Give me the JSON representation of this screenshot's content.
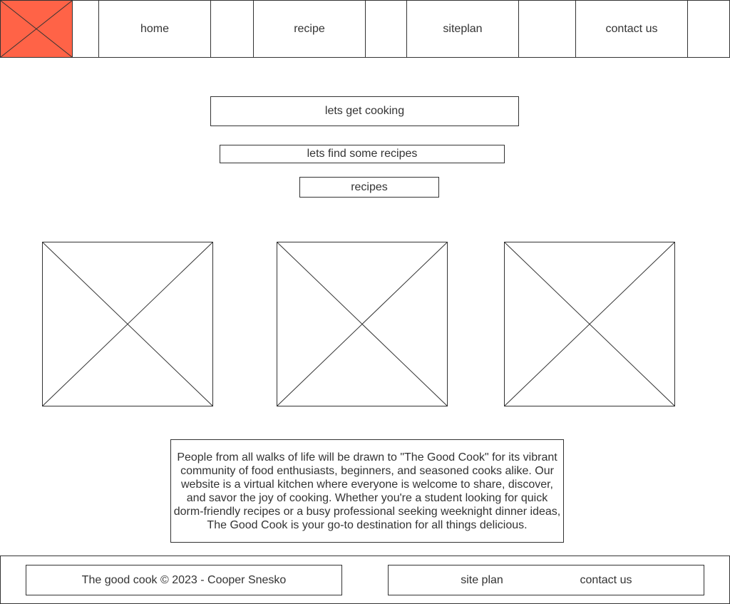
{
  "colors": {
    "logo_fill": "#ff6347",
    "line": "#333333",
    "text": "#333333"
  },
  "header": {
    "logo_icon": "image-placeholder-icon",
    "nav": {
      "home": "home",
      "recipe": "recipe",
      "siteplan": "siteplan",
      "contact": "contact us"
    }
  },
  "main": {
    "heading": "lets get cooking",
    "subheading": "lets find some recipes",
    "recipes_button": "recipes",
    "images": [
      "image-placeholder-icon",
      "image-placeholder-icon",
      "image-placeholder-icon"
    ],
    "description": "People from all walks of life will be drawn to \"The Good Cook\" for its vibrant community of food enthusiasts, beginners, and seasoned cooks alike. Our website is a virtual kitchen where everyone is welcome to share, discover, and savor the joy of cooking. Whether you're a student looking for quick dorm-friendly recipes or a busy professional seeking weeknight dinner ideas, The Good Cook is your go-to destination for all things delicious."
  },
  "footer": {
    "copyright": "The good cook © 2023 - Cooper Snesko",
    "site_plan": "site plan",
    "contact": "contact us"
  }
}
